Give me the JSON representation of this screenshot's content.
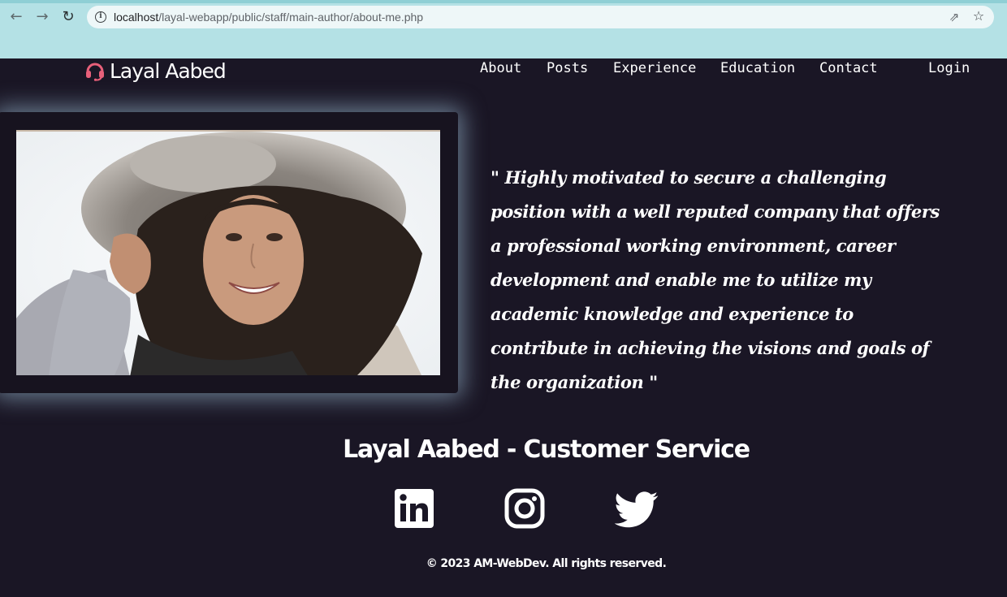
{
  "browser": {
    "url_host": "localhost",
    "url_path": "/layal-webapp/public/staff/main-author/about-me.php",
    "back_icon": "back-arrow-icon",
    "forward_icon": "forward-arrow-icon",
    "reload_icon": "reload-icon"
  },
  "header": {
    "brand_name": "Layal Aabed",
    "brand_icon": "headset-icon",
    "brand_icon_color": "#e8607a",
    "nav": [
      "About",
      "Posts",
      "Experience",
      "Education",
      "Contact",
      "Login"
    ]
  },
  "hero": {
    "photo_alt": "profile-photo",
    "quote": "\" Highly motivated to secure a challenging position with a well reputed company that offers a professional working environment, career development and enable me to utilize my academic knowledge and experience to contribute in achieving the visions and goals of the organization \""
  },
  "footer": {
    "role_title": "Layal Aabed - Customer Service",
    "social": [
      "linkedin-icon",
      "instagram-icon",
      "twitter-icon"
    ],
    "copyright": "© 2023 AM-WebDev. All rights reserved."
  },
  "colors": {
    "page_background": "#1a1625",
    "chrome_background": "#b4e1e5",
    "text": "#ffffff",
    "photo_glow": "#aacde6"
  }
}
